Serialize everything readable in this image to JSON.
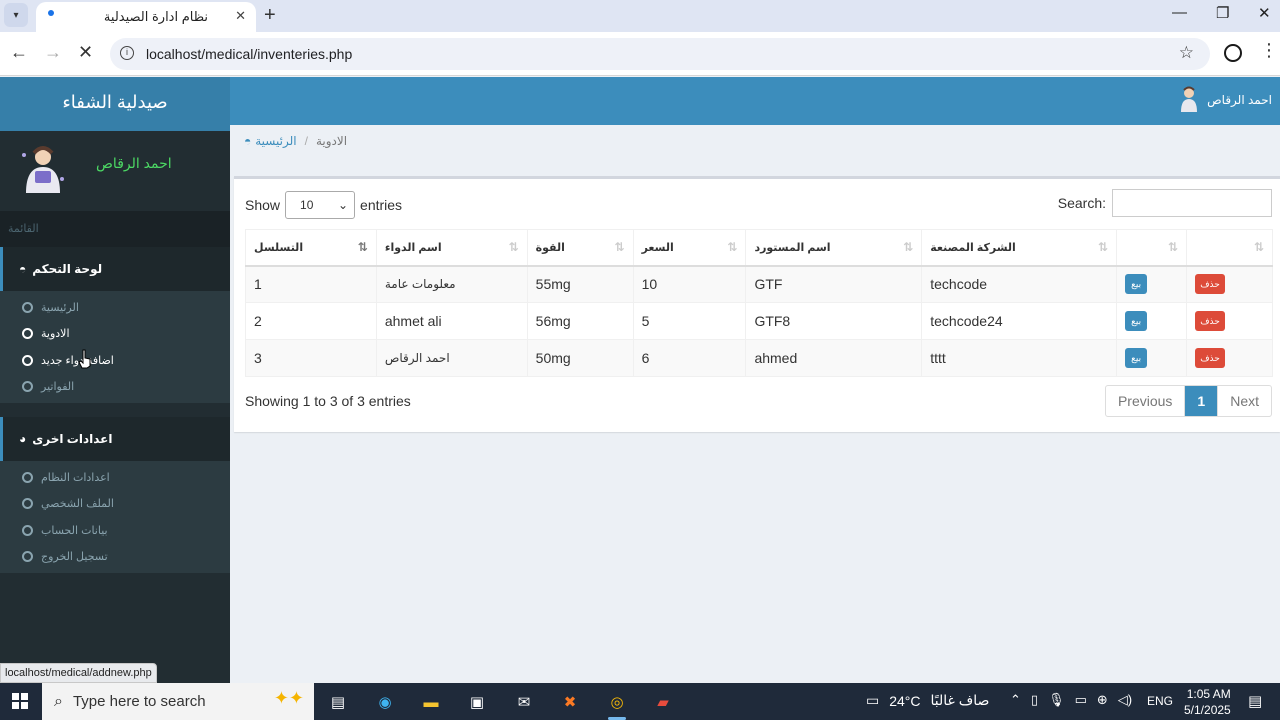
{
  "browser": {
    "tab_title": "نظام ادارة الصيدلية",
    "url": "localhost/medical/inventeries.php",
    "status_url": "localhost/medical/addnew.php"
  },
  "app": {
    "brand": "صيدلية الشفاء",
    "user_name": "احمد الرقاص"
  },
  "sidebar": {
    "header": "القائمة",
    "groups": [
      {
        "label": "لوحة التحكم",
        "items": [
          "الرئيسية",
          "الادوية",
          "اضافة دواء جديد",
          "الفواتير"
        ]
      },
      {
        "label": "اعدادات اخرى",
        "items": [
          "اعدادات النظام",
          "الملف الشخصي",
          "بيانات الحساب",
          "تسجيل الخروج"
        ]
      }
    ]
  },
  "breadcrumb": {
    "home": "الرئيسية",
    "current": "الادوية"
  },
  "table_controls": {
    "show": "Show",
    "entries": "entries",
    "length_value": "10",
    "search_label": "Search:"
  },
  "table": {
    "headers": [
      "التسلسل",
      "اسم الدواء",
      "القوة",
      "السعر",
      "اسم المستورد",
      "الشركة المصنعة",
      "",
      ""
    ],
    "rows": [
      {
        "serial": "1",
        "name": "معلومات عامة",
        "strength": "55mg",
        "price": "10",
        "importer": "GTF",
        "company": "techcode"
      },
      {
        "serial": "2",
        "name": "ahmet ali",
        "strength": "56mg",
        "price": "5",
        "importer": "GTF8",
        "company": "techcode24"
      },
      {
        "serial": "3",
        "name": "احمد الرقاص",
        "strength": "50mg",
        "price": "6",
        "importer": "ahmed",
        "company": "tttt"
      }
    ],
    "sell_label": "بيع",
    "delete_label": "حذف",
    "info": "Showing 1 to 3 of 3 entries",
    "pager": {
      "previous": "Previous",
      "current": "1",
      "next": "Next"
    }
  },
  "taskbar": {
    "search_placeholder": "Type here to search",
    "temperature": "24°C",
    "weather_text": "صاف غالبًا",
    "language": "ENG",
    "time": "1:05 AM",
    "date": "5/1/2025"
  },
  "colors": {
    "header_blue": "#3c8dbc",
    "logo_blue": "#367fa9",
    "sidebar_dark": "#222d32",
    "delete_red": "#dd4b39"
  }
}
